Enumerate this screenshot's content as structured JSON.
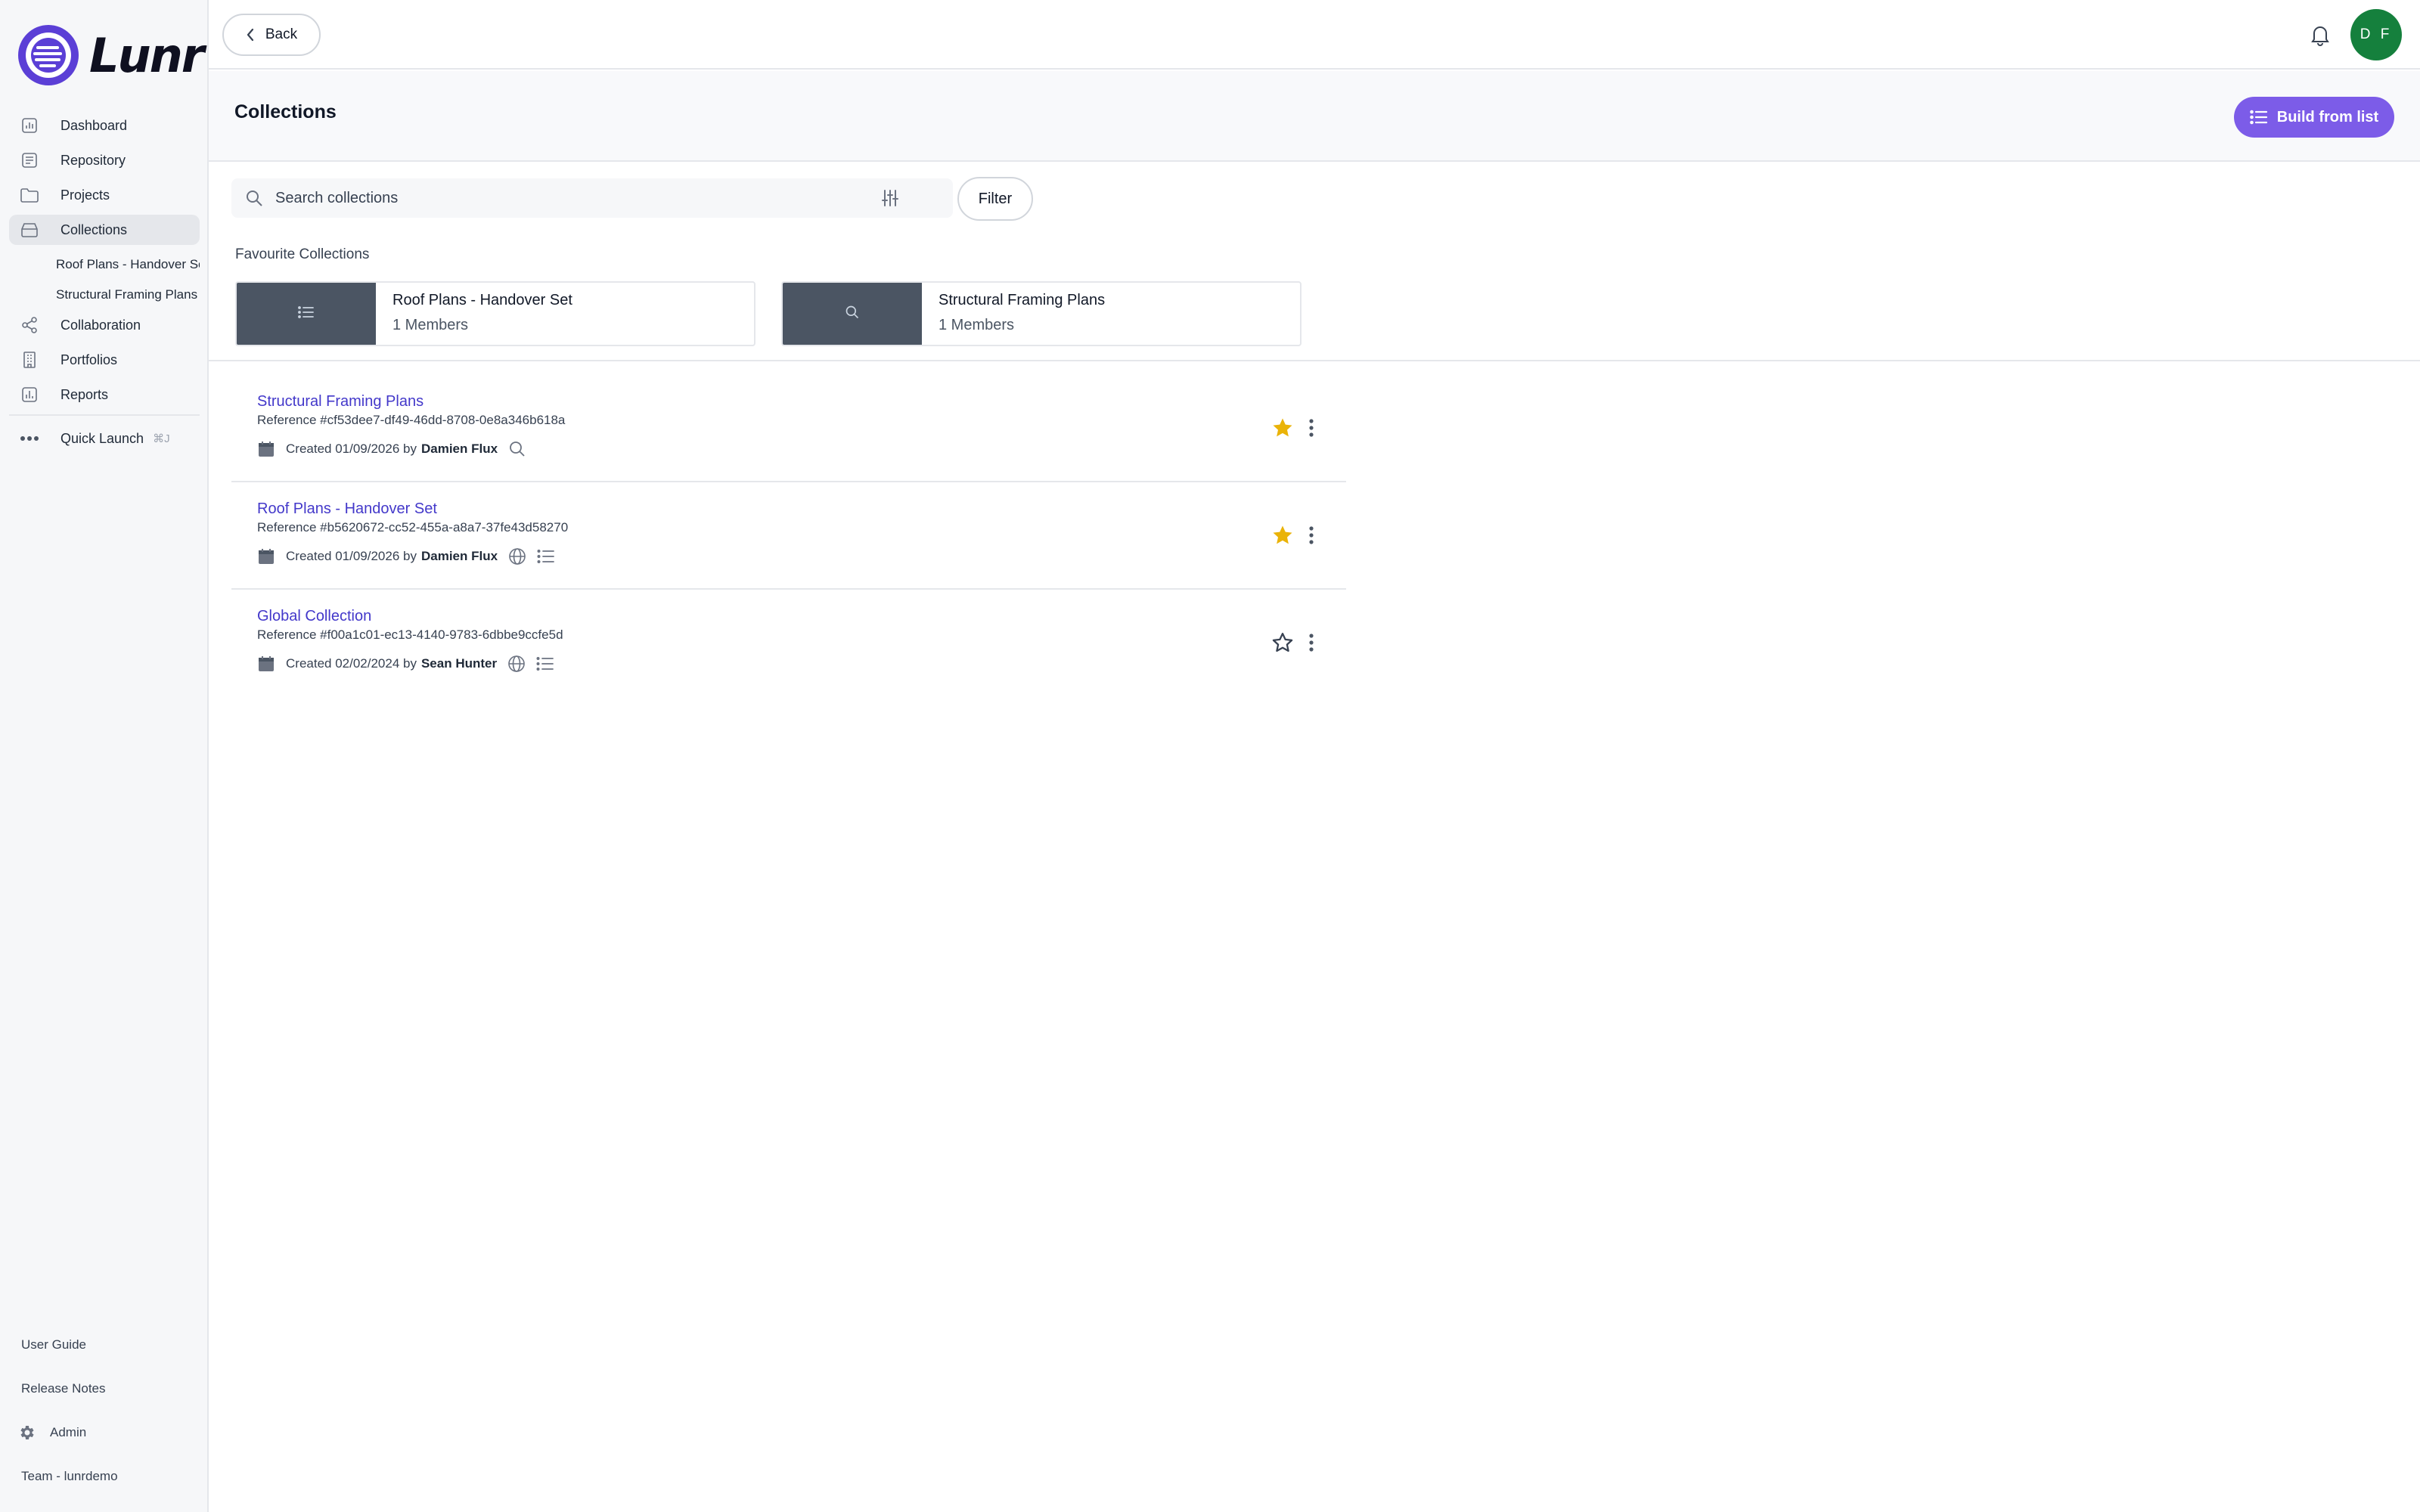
{
  "brand": {
    "name": "Lunr"
  },
  "sidebar": {
    "items": [
      {
        "label": "Dashboard",
        "icon": "chart-icon"
      },
      {
        "label": "Repository",
        "icon": "repository-icon"
      },
      {
        "label": "Projects",
        "icon": "folder-icon"
      },
      {
        "label": "Collections",
        "icon": "collections-icon",
        "active": true
      }
    ],
    "sub_items": [
      {
        "label": "Roof Plans - Handover Set"
      },
      {
        "label": "Structural Framing Plans"
      }
    ],
    "items_after": [
      {
        "label": "Collaboration",
        "icon": "share-icon"
      },
      {
        "label": "Portfolios",
        "icon": "building-icon"
      },
      {
        "label": "Reports",
        "icon": "report-icon"
      }
    ],
    "quick_launch": {
      "label": "Quick Launch",
      "shortcut": "⌘J"
    },
    "bottom": {
      "user_guide": "User Guide",
      "release_notes": "Release Notes",
      "admin": "Admin",
      "team": "Team - lunrdemo"
    }
  },
  "topbar": {
    "back_label": "Back",
    "avatar_initials": "D F",
    "avatar_color": "#15803d"
  },
  "header": {
    "title": "Collections",
    "build_label": "Build from list",
    "accent_color": "#7c5ce8"
  },
  "search": {
    "placeholder": "Search collections",
    "value": "",
    "filter_label": "Filter"
  },
  "favourites": {
    "label": "Favourite Collections",
    "cards": [
      {
        "name": "Roof Plans - Handover Set",
        "members": "1 Members",
        "icon": "list-icon"
      },
      {
        "name": "Structural Framing Plans",
        "members": "1 Members",
        "icon": "search-icon"
      }
    ]
  },
  "collections": [
    {
      "title": "Structural Framing Plans",
      "reference": "Reference #cf53dee7-df49-46dd-8708-0e8a346b618a",
      "created_prefix": "Created 01/09/2026 by",
      "author": "Damien Flux",
      "favourite": true,
      "meta_icons": [
        "search-icon"
      ]
    },
    {
      "title": "Roof Plans - Handover Set",
      "reference": "Reference #b5620672-cc52-455a-a8a7-37fe43d58270",
      "created_prefix": "Created 01/09/2026 by",
      "author": "Damien Flux",
      "favourite": true,
      "meta_icons": [
        "globe-icon",
        "list-icon"
      ]
    },
    {
      "title": "Global Collection",
      "reference": "Reference #f00a1c01-ec13-4140-9783-6dbbe9ccfe5d",
      "created_prefix": "Created 02/02/2024 by",
      "author": "Sean Hunter",
      "favourite": false,
      "meta_icons": [
        "globe-icon",
        "list-icon"
      ]
    }
  ],
  "colors": {
    "star_filled": "#eab308",
    "link": "#4338ca"
  }
}
